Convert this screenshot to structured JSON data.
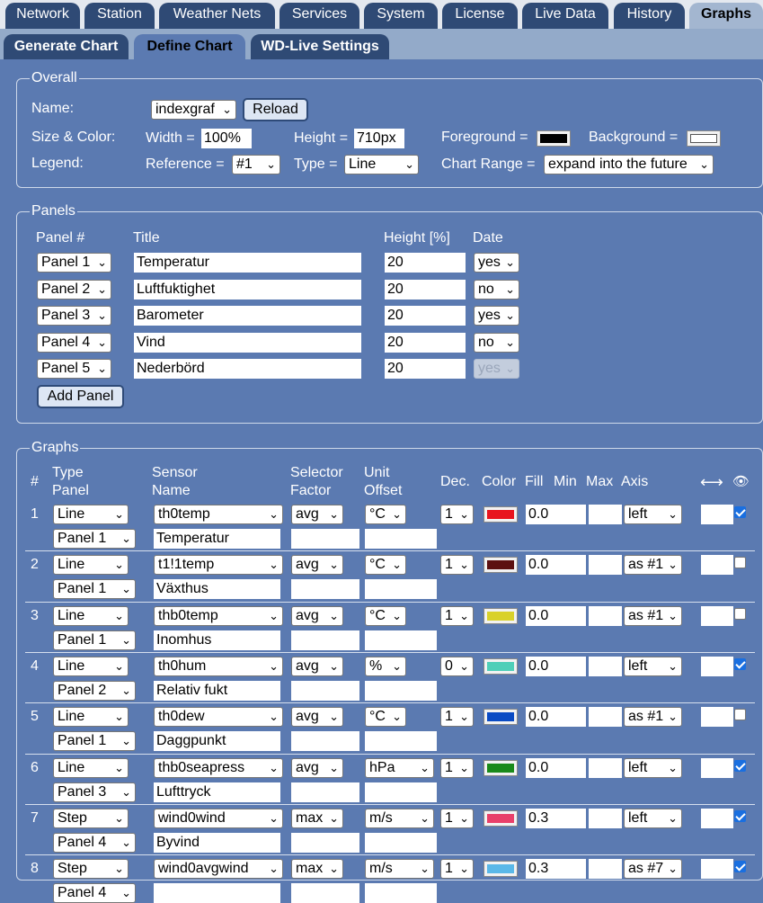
{
  "nav": {
    "tabs": [
      "Network",
      "Station",
      "Weather Nets",
      "Services",
      "System",
      "License",
      "Live Data",
      "History",
      "Graphs"
    ],
    "active": 8,
    "subtabs": [
      "Generate Chart",
      "Define Chart",
      "WD-Live Settings"
    ],
    "subactive": 1
  },
  "overall": {
    "legend": "Overall",
    "name_label": "Name:",
    "name_value": "indexgraf",
    "reload_label": "Reload",
    "size_color_label": "Size & Color:",
    "width_label": "Width =",
    "width_value": "100%",
    "height_label": "Height =",
    "height_value": "710px",
    "foreground_label": "Foreground =",
    "foreground_color": "#000000",
    "background_label": "Background =",
    "background_color": "#ffffff",
    "legend_label": "Legend:",
    "reference_label": "Reference =",
    "reference_value": "#1",
    "type_label": "Type =",
    "type_value": "Line",
    "chart_range_label": "Chart Range =",
    "chart_range_value": "expand into the future"
  },
  "panels": {
    "legend": "Panels",
    "col_panel": "Panel #",
    "col_title": "Title",
    "col_height": "Height [%]",
    "col_date": "Date",
    "rows": [
      {
        "panel": "Panel 1",
        "title": "Temperatur",
        "height": "20",
        "date": "yes",
        "disabled": false
      },
      {
        "panel": "Panel 2",
        "title": "Luftfuktighet",
        "height": "20",
        "date": "no",
        "disabled": false
      },
      {
        "panel": "Panel 3",
        "title": "Barometer",
        "height": "20",
        "date": "yes",
        "disabled": false
      },
      {
        "panel": "Panel 4",
        "title": "Vind",
        "height": "20",
        "date": "no",
        "disabled": false
      },
      {
        "panel": "Panel 5",
        "title": "Nederbörd",
        "height": "20",
        "date": "yes",
        "disabled": true
      }
    ],
    "add_label": "Add Panel"
  },
  "graphs": {
    "legend": "Graphs",
    "h_num": "#",
    "h_type": "Type",
    "h_panel": "Panel",
    "h_sensor": "Sensor",
    "h_name": "Name",
    "h_selector": "Selector",
    "h_factor": "Factor",
    "h_unit": "Unit",
    "h_offset": "Offset",
    "h_dec": "Dec.",
    "h_color": "Color",
    "h_fill": "Fill",
    "h_min": "Min",
    "h_max": "Max",
    "h_axis": "Axis",
    "h_width_icon": "⟷",
    "h_eye_icon": "👁",
    "rows": [
      {
        "num": "1",
        "type": "Line",
        "panel": "Panel 1",
        "sensor": "th0temp",
        "name": "Temperatur",
        "selector": "avg",
        "unit": "°C",
        "dec": "1",
        "color": "#e8141e",
        "fill": "0.0",
        "axis": "left",
        "visible": true
      },
      {
        "num": "2",
        "type": "Line",
        "panel": "Panel 1",
        "sensor": "t1!1temp",
        "name": "Växthus",
        "selector": "avg",
        "unit": "°C",
        "dec": "1",
        "color": "#5c1010",
        "fill": "0.0",
        "axis": "as #1",
        "visible": false
      },
      {
        "num": "3",
        "type": "Line",
        "panel": "Panel 1",
        "sensor": "thb0temp",
        "name": "Inomhus",
        "selector": "avg",
        "unit": "°C",
        "dec": "1",
        "color": "#d9d12a",
        "fill": "0.0",
        "axis": "as #1",
        "visible": false
      },
      {
        "num": "4",
        "type": "Line",
        "panel": "Panel 2",
        "sensor": "th0hum",
        "name": "Relativ fukt",
        "selector": "avg",
        "unit": "%",
        "dec": "0",
        "color": "#4fcfb8",
        "fill": "0.0",
        "axis": "left",
        "visible": true
      },
      {
        "num": "5",
        "type": "Line",
        "panel": "Panel 1",
        "sensor": "th0dew",
        "name": "Daggpunkt",
        "selector": "avg",
        "unit": "°C",
        "dec": "1",
        "color": "#0a4bc4",
        "fill": "0.0",
        "axis": "as #1",
        "visible": false
      },
      {
        "num": "6",
        "type": "Line",
        "panel": "Panel 3",
        "sensor": "thb0seapress",
        "name": "Lufttryck",
        "selector": "avg",
        "unit": "hPa",
        "dec": "1",
        "color": "#1a8a1a",
        "fill": "0.0",
        "axis": "left",
        "visible": true
      },
      {
        "num": "7",
        "type": "Step",
        "panel": "Panel 4",
        "sensor": "wind0wind",
        "name": "Byvind",
        "selector": "max",
        "unit": "m/s",
        "dec": "1",
        "color": "#e8406a",
        "fill": "0.3",
        "axis": "left",
        "visible": true
      },
      {
        "num": "8",
        "type": "Step",
        "panel": "Panel 4",
        "sensor": "wind0avgwind",
        "name": "",
        "selector": "max",
        "unit": "m/s",
        "dec": "1",
        "color": "#5ab8e8",
        "fill": "0.3",
        "axis": "as #7",
        "visible": true
      }
    ]
  }
}
